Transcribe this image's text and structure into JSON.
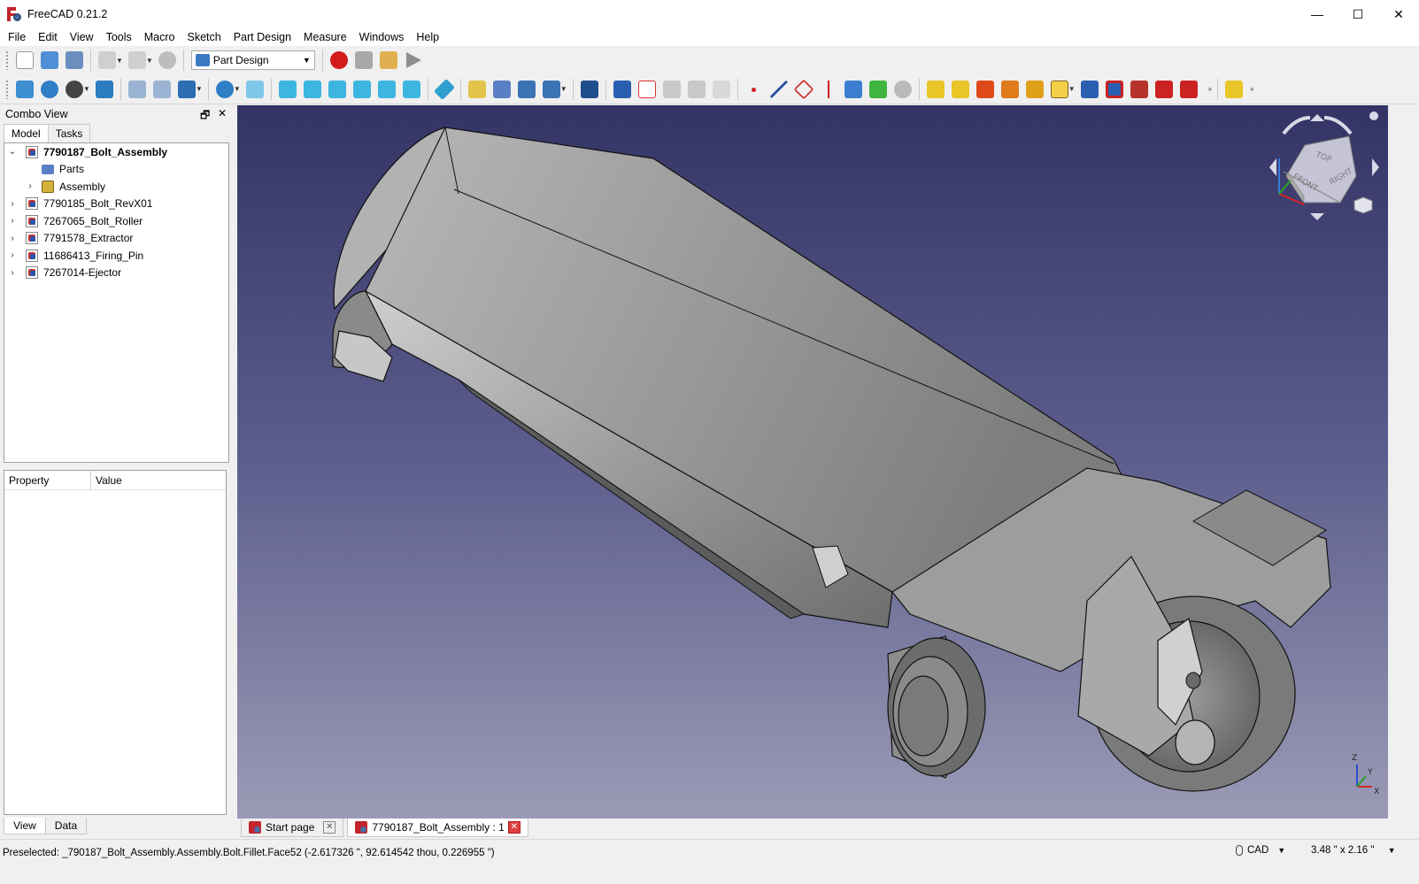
{
  "window": {
    "title": "FreeCAD 0.21.2",
    "minimize": "—",
    "maximize": "☐",
    "close": "✕"
  },
  "menu": [
    "File",
    "Edit",
    "View",
    "Tools",
    "Macro",
    "Sketch",
    "Part Design",
    "Measure",
    "Windows",
    "Help"
  ],
  "workbench": {
    "selected": "Part Design"
  },
  "combo_view": {
    "title": "Combo View",
    "tabs": [
      "Model",
      "Tasks"
    ],
    "tree": [
      {
        "label": "7790187_Bolt_Assembly",
        "expanded": true
      },
      {
        "label": "Parts"
      },
      {
        "label": "Assembly"
      },
      {
        "label": "7790185_Bolt_RevX01"
      },
      {
        "label": "7267065_Bolt_Roller"
      },
      {
        "label": "7791578_Extractor"
      },
      {
        "label": "11686413_Firing_Pin"
      },
      {
        "label": "7267014-Ejector"
      }
    ],
    "property_headers": {
      "property": "Property",
      "value": "Value"
    },
    "bottom_tabs": [
      "View",
      "Data"
    ]
  },
  "navcube": {
    "top": "TOP",
    "front": "FRONT",
    "right": "RIGHT"
  },
  "axes": {
    "x": "X",
    "y": "Y",
    "z": "Z"
  },
  "document_tabs": [
    {
      "label": "Start page"
    },
    {
      "label": "7790187_Bolt_Assembly : 1"
    }
  ],
  "status": {
    "text": "Preselected: _790187_Bolt_Assembly.Assembly.Bolt.Fillet.Face52 (-2.617326 \", 92.614542 thou, 0.226955 \")",
    "nav_style": "CAD",
    "dimensions": "3.48 \" x 2.16 \""
  },
  "colors": {
    "bg_top": "#333465",
    "bg_bottom": "#9a9ab6",
    "model_gray": "#8e8e8e"
  }
}
